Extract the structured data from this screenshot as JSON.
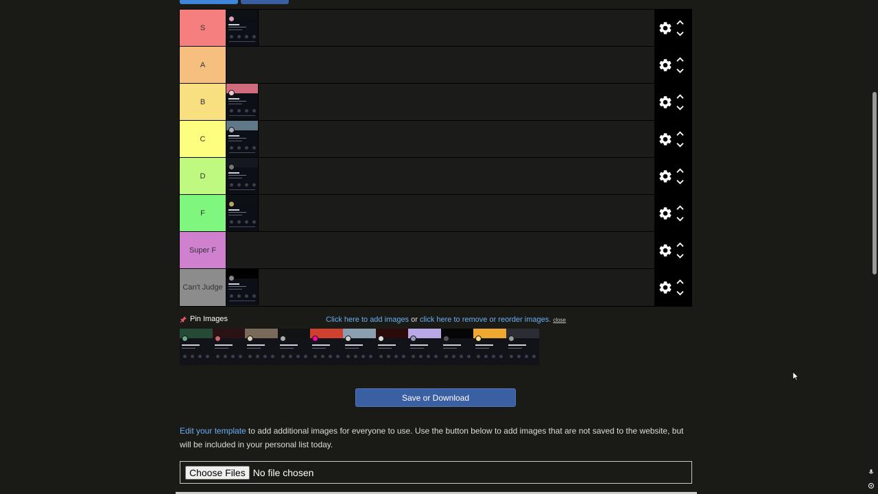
{
  "tiers": [
    {
      "label": "S",
      "color": "#f57f7f",
      "cards": [
        {
          "header": "#0d1014",
          "avatar": "#d9a0b8"
        }
      ]
    },
    {
      "label": "A",
      "color": "#f7bf7f",
      "cards": []
    },
    {
      "label": "B",
      "color": "#f8df7f",
      "cards": [
        {
          "header": "#d06c7e",
          "avatar": "#f2c5cf"
        }
      ]
    },
    {
      "label": "C",
      "color": "#fdfd7f",
      "cards": [
        {
          "header": "#607888",
          "avatar": "#aab"
        }
      ]
    },
    {
      "label": "D",
      "color": "#bff97f",
      "cards": [
        {
          "header": "#141820",
          "avatar": "#777"
        }
      ]
    },
    {
      "label": "F",
      "color": "#7ff77f",
      "cards": [
        {
          "header": "#0d1014",
          "avatar": "#b8a36a"
        }
      ]
    },
    {
      "label": "Super F",
      "color": "#cf80cf",
      "cards": []
    },
    {
      "label": "Can't Judge",
      "color": "#8c8c8c",
      "cards": [
        {
          "header": "#000000",
          "avatar": "#888"
        }
      ]
    }
  ],
  "pin_label": "Pin Images",
  "links": {
    "add_images": "Click here to add images",
    "or": " or ",
    "reorder_images": "click here to remove or reorder images.",
    "close": "close"
  },
  "pool_cards": [
    {
      "header": "#254a35",
      "avatar": "#6a8"
    },
    {
      "header": "#2a1214",
      "avatar": "#c66"
    },
    {
      "header": "#7a6a5a",
      "avatar": "#dcb"
    },
    {
      "header": "#101214",
      "avatar": "#aaa"
    },
    {
      "header": "#d0402e",
      "avatar": "#f0a"
    },
    {
      "header": "#8aa0b0",
      "avatar": "#ccc"
    },
    {
      "header": "#2a0a0a",
      "avatar": "#ddd"
    },
    {
      "header": "#b8a8e8",
      "avatar": "#99b"
    },
    {
      "header": "#050505",
      "avatar": "#555"
    },
    {
      "header": "#f0a830",
      "avatar": "#fd8"
    },
    {
      "header": "#2c2c34",
      "avatar": "#999"
    }
  ],
  "save_button": "Save or Download",
  "info": {
    "link": "Edit your template",
    "text": " to add additional images for everyone to use. Use the button below to add images that are not saved to the website, but will be included in your personal list today."
  },
  "file_input": {
    "button": "Choose Files",
    "status": "No file chosen"
  },
  "icons": {
    "gear": "gear-icon",
    "up": "chevron-up-icon",
    "down": "chevron-down-icon",
    "pin": "pin-icon",
    "mic": "microphone-icon",
    "lens": "lens-icon"
  }
}
